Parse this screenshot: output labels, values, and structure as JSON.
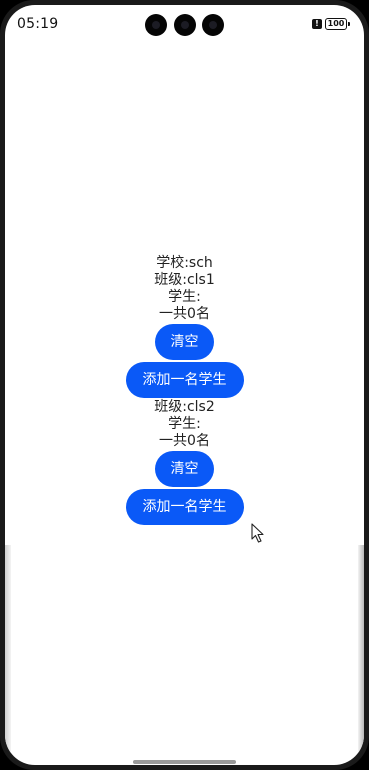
{
  "status_bar": {
    "time": "05:19",
    "alert_glyph": "!",
    "battery": "100"
  },
  "school": {
    "label": "学校:sch"
  },
  "classes": [
    {
      "class_label": "班级:cls1",
      "students_label": "学生:",
      "count_label": "一共0名",
      "clear_button": "清空",
      "add_button": "添加一名学生"
    },
    {
      "class_label": "班级:cls2",
      "students_label": "学生:",
      "count_label": "一共0名",
      "clear_button": "清空",
      "add_button": "添加一名学生"
    }
  ],
  "icons": {
    "camera": "camera-icon",
    "alert": "alert-icon",
    "battery": "battery-icon",
    "cursor": "mouse-pointer-icon"
  },
  "colors": {
    "button": "#0a59f7",
    "background": "#ffffff",
    "text": "#222222"
  }
}
